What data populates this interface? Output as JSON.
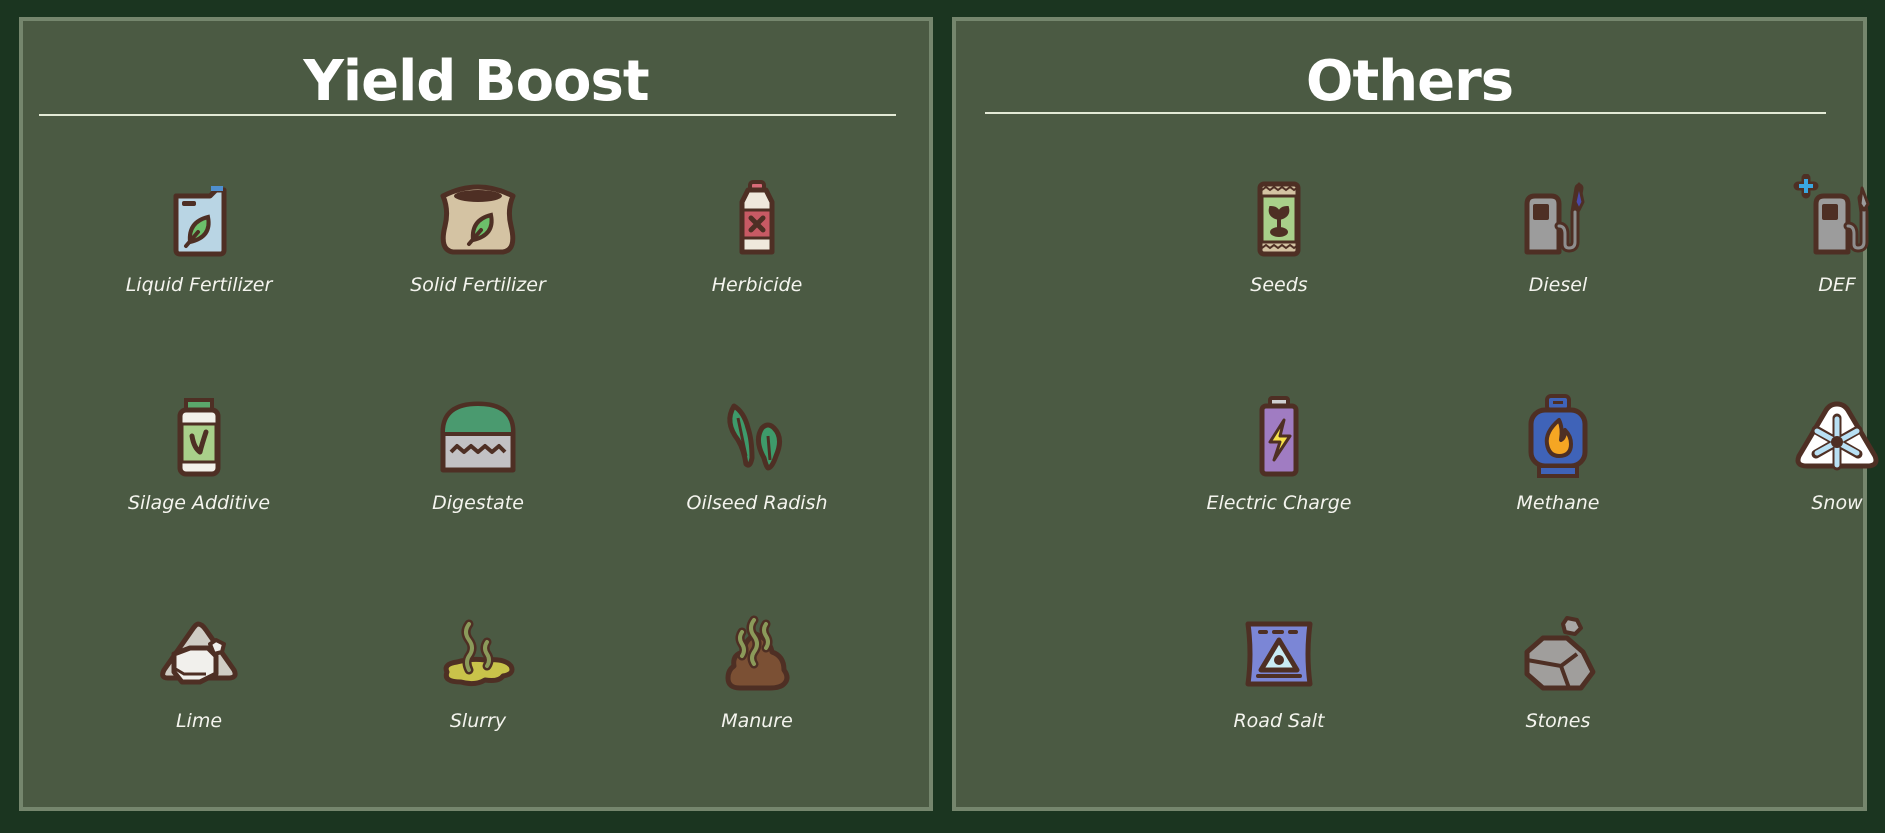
{
  "panels": [
    {
      "title": "Yield Boost",
      "items": [
        {
          "label": "Liquid Fertilizer",
          "icon": "liquid-fertilizer-canister-icon"
        },
        {
          "label": "Solid Fertilizer",
          "icon": "solid-fertilizer-sack-icon"
        },
        {
          "label": "Herbicide",
          "icon": "herbicide-bottle-icon"
        },
        {
          "label": "Silage Additive",
          "icon": "silage-additive-jar-icon"
        },
        {
          "label": "Digestate",
          "icon": "digestate-icon"
        },
        {
          "label": "Oilseed Radish",
          "icon": "oilseed-radish-leaves-icon"
        },
        {
          "label": "Lime",
          "icon": "lime-pile-icon"
        },
        {
          "label": "Slurry",
          "icon": "slurry-puddle-icon"
        },
        {
          "label": "Manure",
          "icon": "manure-pile-icon"
        }
      ]
    },
    {
      "title": "Others",
      "items": [
        {
          "label": "Seeds",
          "icon": "seed-bag-icon"
        },
        {
          "label": "Diesel",
          "icon": "diesel-pump-icon"
        },
        {
          "label": "DEF",
          "icon": "def-pump-icon"
        },
        {
          "label": "Electric Charge",
          "icon": "battery-icon"
        },
        {
          "label": "Methane",
          "icon": "gas-cylinder-icon"
        },
        {
          "label": "Snow",
          "icon": "snow-pile-icon"
        },
        {
          "label": "Road Salt",
          "icon": "road-salt-bag-icon"
        },
        {
          "label": "Stones",
          "icon": "stones-icon"
        }
      ]
    }
  ],
  "colors": {
    "background": "#1b3520",
    "panel": "#4b5a43",
    "panel_border": "#75866d",
    "outline": "#4e2f24",
    "text": "#f4f4ee"
  }
}
